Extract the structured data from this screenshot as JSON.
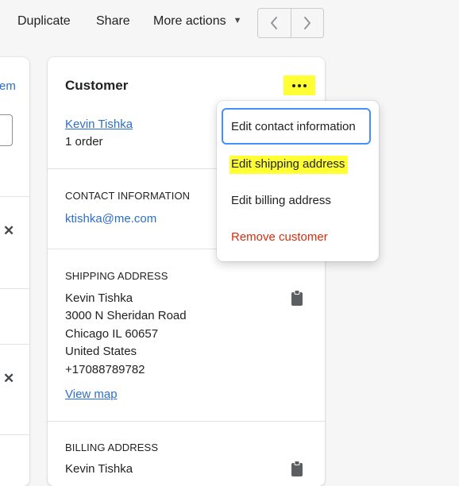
{
  "toolbar": {
    "duplicate": "Duplicate",
    "share": "Share",
    "more_actions": "More actions",
    "prev_icon": "chevron-left-icon",
    "next_icon": "chevron-right-icon"
  },
  "left_panel": {
    "link_fragment": "em"
  },
  "customer_card": {
    "title": "Customer",
    "more_icon": "more-horizontal-icon",
    "customer_name": "Kevin Tishka",
    "order_count": "1 order",
    "contact": {
      "heading": "CONTACT INFORMATION",
      "email": "ktishka@me.com"
    },
    "shipping": {
      "heading": "SHIPPING ADDRESS",
      "lines": [
        "Kevin Tishka",
        "3000 N Sheridan Road",
        "Chicago IL 60657",
        "United States",
        "+17088789782"
      ],
      "map_link": "View map",
      "copy_icon": "clipboard-icon"
    },
    "billing": {
      "heading": "BILLING ADDRESS",
      "name": "Kevin Tishka",
      "copy_icon": "clipboard-icon"
    }
  },
  "menu": {
    "items": [
      {
        "label": "Edit contact information",
        "focused": true
      },
      {
        "label": "Edit shipping address",
        "highlighted": true
      },
      {
        "label": "Edit billing address"
      },
      {
        "label": "Remove customer",
        "destructive": true
      }
    ]
  },
  "colors": {
    "link": "#2c6ecb",
    "destructive": "#d82c0d",
    "highlight": "#ffff33",
    "focus_ring": "#458fff"
  }
}
